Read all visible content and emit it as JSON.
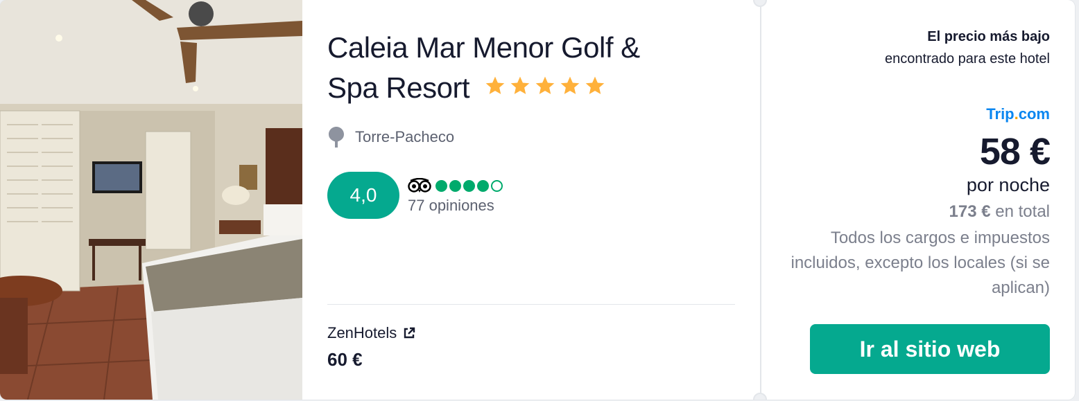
{
  "hotel": {
    "name_line1": "Caleia Mar Menor Golf &",
    "name_line2": "Spa Resort",
    "stars": 5,
    "location": "Torre-Pacheco"
  },
  "rating": {
    "score": "4,0",
    "tripadvisor_bubbles": 4,
    "tripadvisor_max": 5,
    "reviews": "77 opiniones"
  },
  "alternative": {
    "provider": "ZenHotels",
    "price": "60 €"
  },
  "offer": {
    "lowest_label": "El precio más bajo",
    "found_label": "encontrado para este hotel",
    "partner_main": "Trip",
    "partner_dot": ".",
    "partner_tld": "com",
    "price": "58 €",
    "per_night": "por noche",
    "total_amount": "173 €",
    "total_label": "en total",
    "taxes_note": "Todos los cargos e impuestos incluidos, excepto los locales (si se aplican)",
    "cta_label": "Ir al sitio web"
  },
  "colors": {
    "accent": "#05a98f",
    "star": "#ffb13b",
    "tripadvisor": "#00aa6c",
    "partner": "#0a86f0",
    "muted": "#7b7f8c"
  },
  "icons": [
    "star-icon",
    "location-pin-icon",
    "tripadvisor-owl-icon",
    "external-link-icon"
  ]
}
